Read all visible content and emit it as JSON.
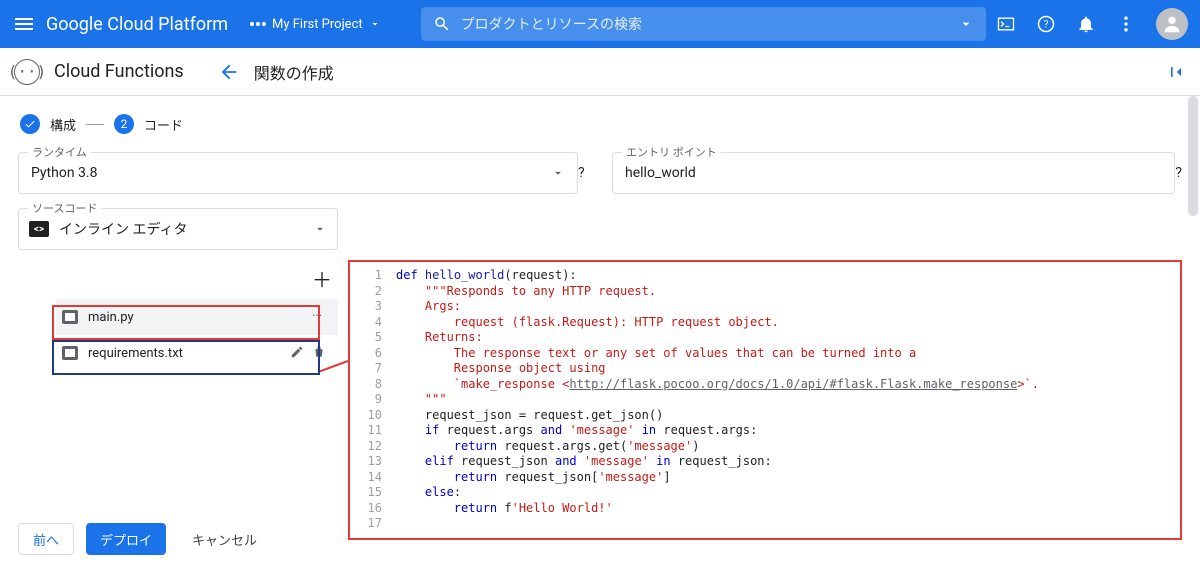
{
  "topbar": {
    "brand": "Google Cloud Platform",
    "project_name": "My First Project",
    "search_placeholder": "プロダクトとリソースの検索"
  },
  "svcbar": {
    "logo_text": "(··)",
    "service_name": "Cloud Functions",
    "page_title": "関数の作成"
  },
  "stepper": {
    "step1_label": "構成",
    "step2_num": "2",
    "step2_label": "コード"
  },
  "fields": {
    "runtime_label": "ランタイム",
    "runtime_value": "Python 3.8",
    "entry_label": "エントリ ポイント",
    "entry_value": "hello_world",
    "source_label": "ソースコード",
    "source_value": "インライン エディタ"
  },
  "files": {
    "list": [
      {
        "name": "main.py",
        "selected": true,
        "more": true
      },
      {
        "name": "requirements.txt",
        "selected": false,
        "edit": true
      }
    ]
  },
  "editor": {
    "lines": [
      {
        "n": 1,
        "html": "<span class='kw'>def</span> <span class='fn'>hello_world</span>(request):"
      },
      {
        "n": 2,
        "html": "    <span class='str'>\"\"\"Responds to any HTTP request.</span>"
      },
      {
        "n": 3,
        "html": "<span class='str'>    Args:</span>"
      },
      {
        "n": 4,
        "html": "<span class='str'>        request (flask.Request): HTTP request object.</span>"
      },
      {
        "n": 5,
        "html": "<span class='str'>    Returns:</span>"
      },
      {
        "n": 6,
        "html": "<span class='str'>        The response text or any set of values that can be turned into a</span>"
      },
      {
        "n": 7,
        "html": "<span class='str'>        Response object using</span>"
      },
      {
        "n": 8,
        "html": "<span class='str'>        `make_response &lt;</span><span class='lnk'>http://flask.pocoo.org/docs/1.0/api/#flask.Flask.make_response</span><span class='str'>&gt;`.</span>"
      },
      {
        "n": 9,
        "html": "<span class='str'>    \"\"\"</span>"
      },
      {
        "n": 10,
        "html": "    request_json = request.get_json()"
      },
      {
        "n": 11,
        "html": "    <span class='kw'>if</span> request.args <span class='kw'>and</span> <span class='str'>'message'</span> <span class='kw'>in</span> request.args:"
      },
      {
        "n": 12,
        "html": "        <span class='kw'>return</span> request.args.get(<span class='str'>'message'</span>)"
      },
      {
        "n": 13,
        "html": "    <span class='kw'>elif</span> request_json <span class='kw'>and</span> <span class='str'>'message'</span> <span class='kw'>in</span> request_json:"
      },
      {
        "n": 14,
        "html": "        <span class='kw'>return</span> request_json[<span class='str'>'message'</span>]"
      },
      {
        "n": 15,
        "html": "    <span class='kw'>else</span>:"
      },
      {
        "n": 16,
        "html": "        <span class='kw'>return</span> f<span class='str'>'Hello World!'</span>"
      },
      {
        "n": 17,
        "html": ""
      }
    ]
  },
  "bottom": {
    "back": "前へ",
    "deploy": "デプロイ",
    "cancel": "キャンセル"
  }
}
